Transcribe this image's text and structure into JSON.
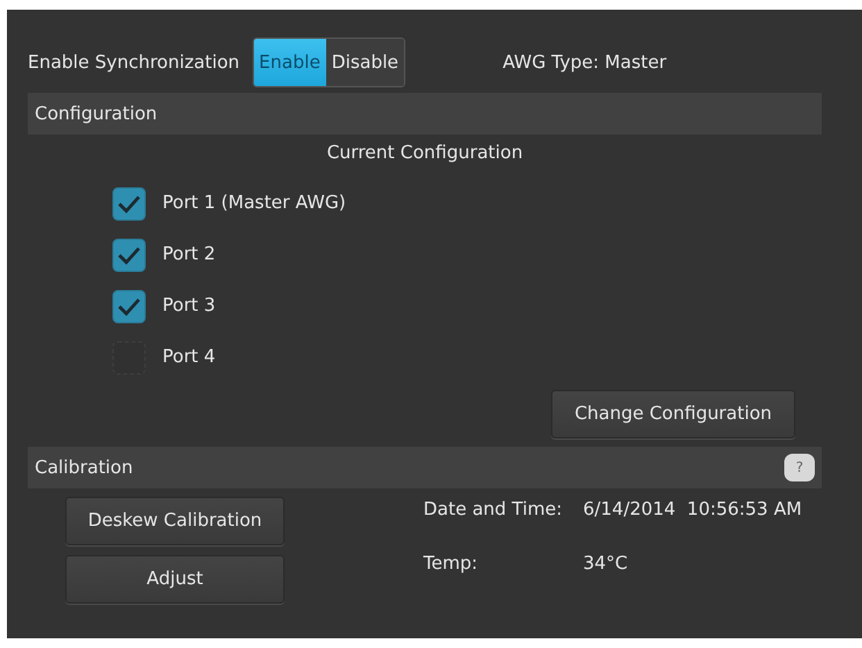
{
  "sync": {
    "label": "Enable Synchronization",
    "options": [
      {
        "label": "Enable",
        "selected": true
      },
      {
        "label": "Disable",
        "selected": false
      }
    ],
    "awg_type": "AWG Type: Master"
  },
  "configuration": {
    "title": "Configuration",
    "subtitle": "Current Configuration",
    "ports": [
      {
        "label": "Port 1 (Master AWG)",
        "checked": true
      },
      {
        "label": "Port 2",
        "checked": true
      },
      {
        "label": "Port 3",
        "checked": true
      },
      {
        "label": "Port 4",
        "checked": false
      }
    ],
    "button": "Change Configuration"
  },
  "calibration": {
    "title": "Calibration",
    "help": "?",
    "buttons": [
      "Deskew Calibration",
      "Adjust"
    ],
    "info": [
      {
        "label": "Date and Time:",
        "value": "6/14/2014  10:56:53 AM"
      },
      {
        "label": "Temp:",
        "value": "34°C"
      }
    ]
  }
}
